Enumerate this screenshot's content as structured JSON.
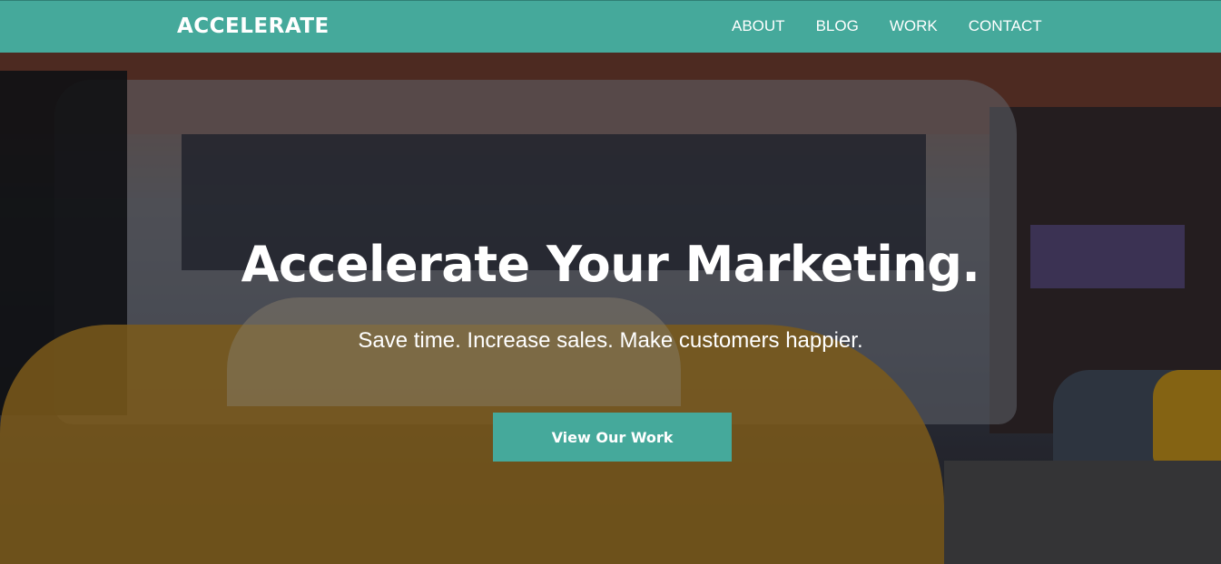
{
  "header": {
    "logo": "ACCELERATE",
    "nav": [
      {
        "label": "ABOUT"
      },
      {
        "label": "BLOG"
      },
      {
        "label": "WORK"
      },
      {
        "label": "CONTACT"
      }
    ]
  },
  "hero": {
    "title": "Accelerate Your Marketing.",
    "subtitle": "Save time. Increase sales. Make customers happier.",
    "cta_label": "View Our Work"
  },
  "colors": {
    "accent": "#45a99b",
    "text": "#ffffff"
  }
}
